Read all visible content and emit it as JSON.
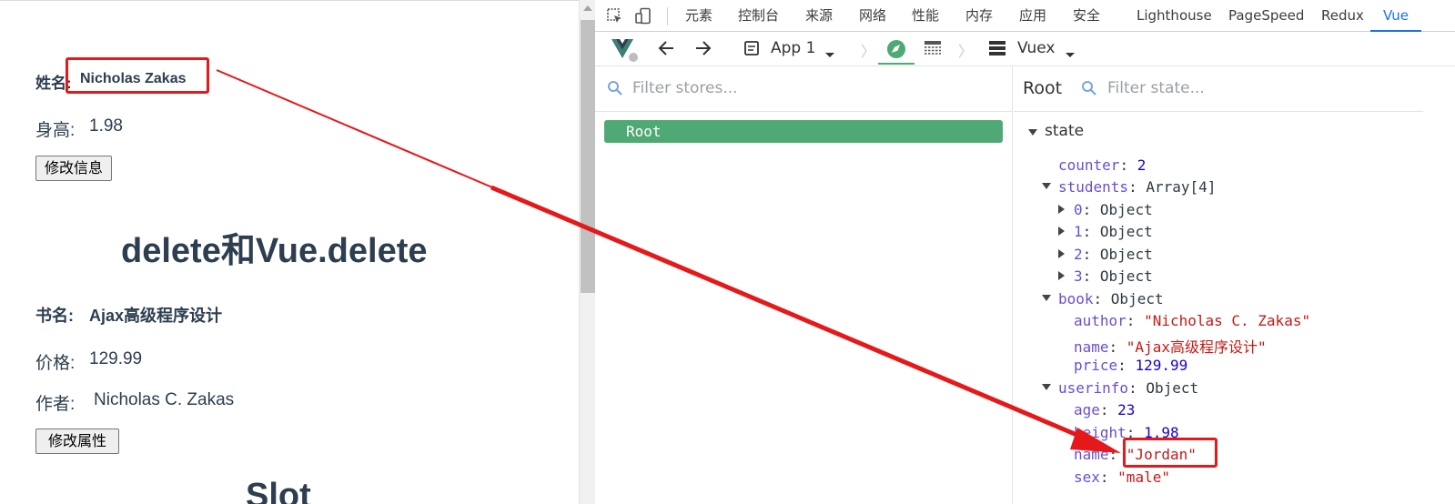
{
  "page": {
    "name_label": "姓名:",
    "name_value": "Nicholas Zakas",
    "height_label": "身高:",
    "height_value": "1.98",
    "edit_info_button": "修改信息",
    "section1_title": "delete和Vue.delete",
    "book_label": "书名:",
    "book_value": "Ajax高级程序设计",
    "price_label": "价格:",
    "price_value": "129.99",
    "author_label": "作者:",
    "author_value": "Nicholas C. Zakas",
    "edit_attr_button": "修改属性",
    "section2_title": "Slot"
  },
  "devtools": {
    "tabs": [
      "元素",
      "控制台",
      "来源",
      "网络",
      "性能",
      "内存",
      "应用",
      "安全",
      "Lighthouse",
      "PageSpeed",
      "Redux",
      "Vue"
    ],
    "active_tab": "Vue",
    "app_selector": "App 1",
    "vuex_label": "Vuex",
    "filter_stores_placeholder": "Filter stores...",
    "root_item": "Root",
    "state_pane_title": "Root",
    "filter_state_placeholder": "Filter state...",
    "state_header": "state",
    "state": {
      "counter": {
        "key": "counter",
        "value": "2"
      },
      "students": {
        "key": "students",
        "value": "Array[4]",
        "items": [
          {
            "key": "0",
            "value": "Object"
          },
          {
            "key": "1",
            "value": "Object"
          },
          {
            "key": "2",
            "value": "Object"
          },
          {
            "key": "3",
            "value": "Object"
          }
        ]
      },
      "book": {
        "key": "book",
        "value": "Object",
        "author": {
          "key": "author",
          "value": "\"Nicholas C. Zakas\""
        },
        "name": {
          "key": "name",
          "value": "\"Ajax高级程序设计\""
        },
        "price": {
          "key": "price",
          "value": "129.99"
        }
      },
      "userinfo": {
        "key": "userinfo",
        "value": "Object",
        "age": {
          "key": "age",
          "value": "23"
        },
        "height": {
          "key": "height",
          "value": "1.98"
        },
        "name": {
          "key": "name",
          "value": "\"Jordan\""
        },
        "sex": {
          "key": "sex",
          "value": "\"male\""
        }
      }
    }
  },
  "colors": {
    "annotation_red": "#e5191a",
    "vue_green": "#4fa974",
    "active_blue": "#1a73e8"
  }
}
